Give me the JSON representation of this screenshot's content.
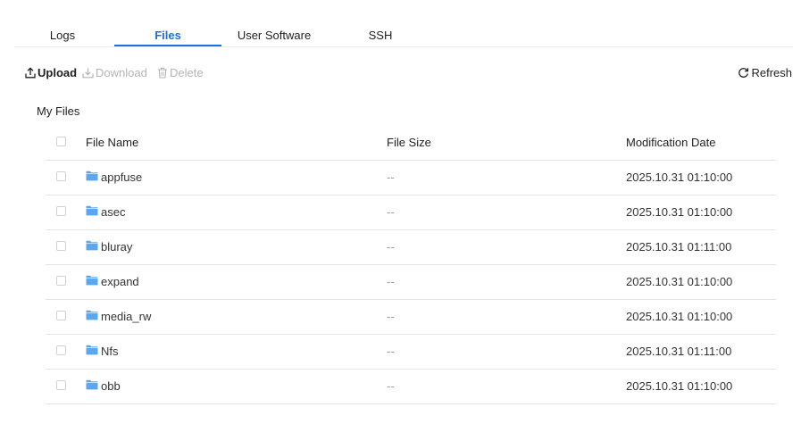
{
  "tabs": [
    {
      "label": "Logs",
      "active": false
    },
    {
      "label": "Files",
      "active": true
    },
    {
      "label": "User Software",
      "active": false
    },
    {
      "label": "SSH",
      "active": false
    }
  ],
  "toolbar": {
    "upload": "Upload",
    "download": "Download",
    "delete": "Delete",
    "refresh": "Refresh"
  },
  "section_title": "My Files",
  "table": {
    "headers": {
      "name": "File Name",
      "size": "File Size",
      "date": "Modification Date"
    },
    "rows": [
      {
        "name": "appfuse",
        "size": "--",
        "date": "2025.10.31 01:10:00",
        "icon": "folder-icon"
      },
      {
        "name": "asec",
        "size": "--",
        "date": "2025.10.31 01:10:00",
        "icon": "folder-icon"
      },
      {
        "name": "bluray",
        "size": "--",
        "date": "2025.10.31 01:11:00",
        "icon": "folder-icon"
      },
      {
        "name": "expand",
        "size": "--",
        "date": "2025.10.31 01:10:00",
        "icon": "folder-icon"
      },
      {
        "name": "media_rw",
        "size": "--",
        "date": "2025.10.31 01:10:00",
        "icon": "folder-icon"
      },
      {
        "name": "Nfs",
        "size": "--",
        "date": "2025.10.31 01:11:00",
        "icon": "folder-icon"
      },
      {
        "name": "obb",
        "size": "--",
        "date": "2025.10.31 01:10:00",
        "icon": "folder-icon"
      }
    ]
  },
  "colors": {
    "accent": "#1e6fd9",
    "folder": "#5aa7ef",
    "disabled": "#b4b4b4"
  }
}
